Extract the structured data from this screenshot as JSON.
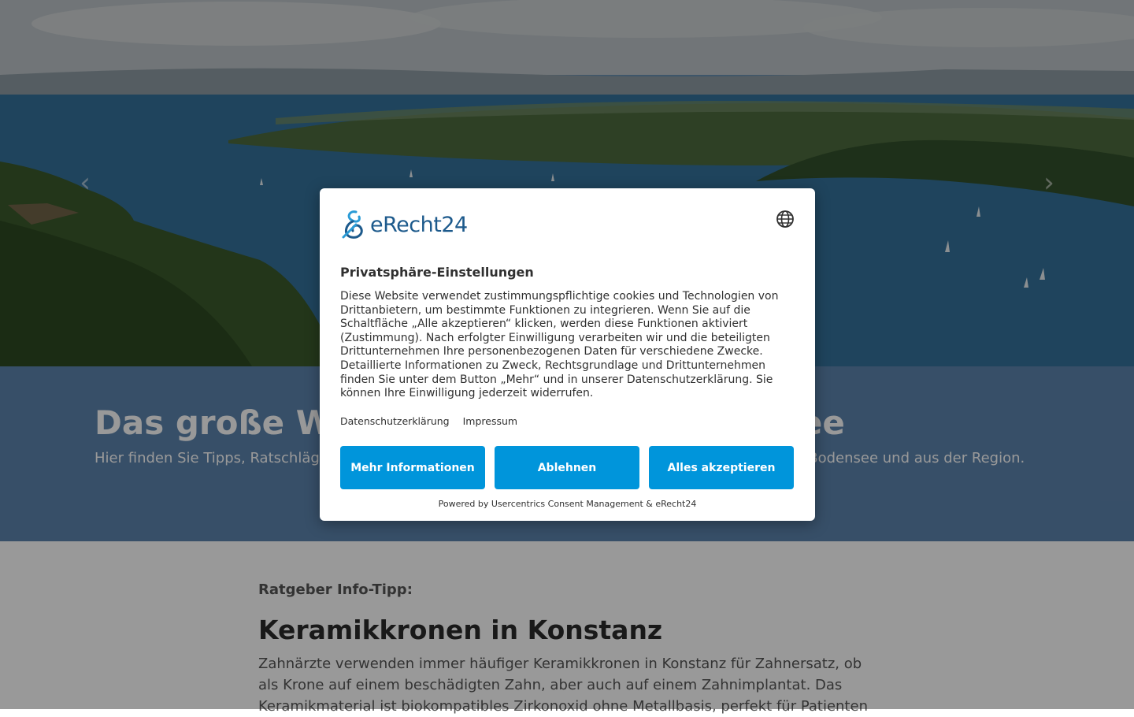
{
  "hero": {
    "prev_arrow": "‹",
    "next_arrow": "›"
  },
  "band": {
    "title": "Das große Wissensportal vom Bodensee",
    "subtitle": "Hier finden Sie Tipps, Ratschläge und Informationen zu verschiedenen Themen von Fachleuten vom Bodensee und aus der Region."
  },
  "article": {
    "kicker": "Ratgeber Info-Tipp:",
    "headline": "Keramikkronen in Konstanz",
    "body": "Zahnärzte verwenden immer häufiger Keramikkronen in Konstanz für Zahnersatz, ob als Krone auf einem beschädigten Zahn, aber auch auf einem Zahnimplantat. Das Keramikmaterial ist biokompatibles Zirkonoxid ohne Metallbasis, perfekt für Patienten"
  },
  "consent": {
    "logo_text": "eRecht24",
    "title": "Privatsphäre-Einstellungen",
    "text": "Diese Website verwendet zustimmungspflichtige cookies und Technologien von Drittanbietern, um bestimmte Funktionen zu integrieren. Wenn Sie auf die Schaltfläche „Alle akzeptieren“ klicken, werden diese Funktionen aktiviert (Zustimmung). Nach erfolgter Einwilligung verarbeiten wir und die beteiligten Drittunternehmen Ihre personenbezogenen Daten für verschiedene Zwecke. Detaillierte Informationen zu Zweck, Rechtsgrundlage und Drittunternehmen finden Sie unter dem Button „Mehr“ und in unserer Datenschutzerklärung. Sie können Ihre Einwilligung jederzeit widerrufen.",
    "links": [
      "Datenschutzerklärung",
      "Impressum"
    ],
    "buttons": {
      "more": "Mehr Informationen",
      "deny": "Ablehnen",
      "accept": "Alles akzeptieren"
    },
    "powered_by": "Powered by Usercentrics Consent Management & eRecht24",
    "accent_color": "#0095db"
  }
}
